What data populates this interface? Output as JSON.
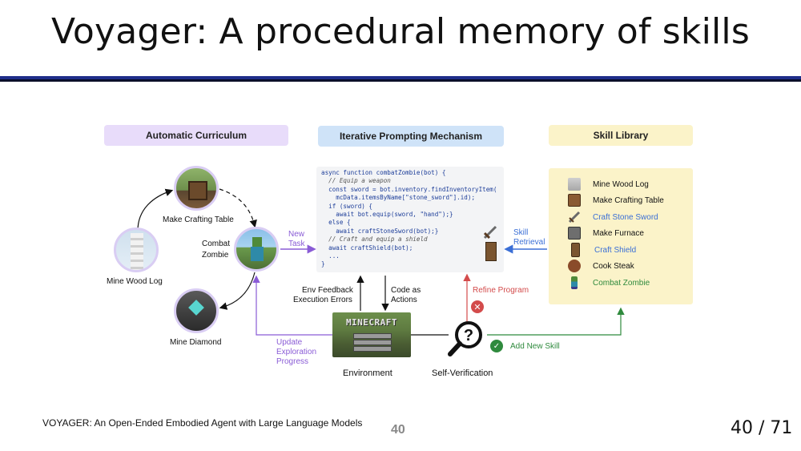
{
  "slide": {
    "title": "Voyager: A procedural memory of skills",
    "footer_left": "VOYAGER: An Open-Ended Embodied Agent with Large Language Models",
    "footer_center": "40",
    "page_indicator": "40 / 71"
  },
  "diagram": {
    "headers": {
      "curriculum": "Automatic Curriculum",
      "iterative": "Iterative Prompting Mechanism",
      "library": "Skill Library"
    },
    "curriculum_nodes": {
      "crafting_table": "Make Crafting Table",
      "combat_zombie_1": "Combat",
      "combat_zombie_2": "Zombie",
      "wood_log": "Mine Wood Log",
      "diamond": "Mine Diamond"
    },
    "code_lines": [
      "async function combatZombie(bot) {",
      "  // Equip a weapon",
      "  const sword = bot.inventory.findInventoryItem(",
      "    mcData.itemsByName[\"stone_sword\"].id);",
      "  if (sword) {",
      "    await bot.equip(sword, \"hand\");}",
      "  else {",
      "    await craftStoneSword(bot);}",
      "  // Craft and equip a shield",
      "  await craftShield(bot);",
      "  ...",
      "}"
    ],
    "labels": {
      "new_task_1": "New",
      "new_task_2": "Task",
      "skill_retrieval_1": "Skill",
      "skill_retrieval_2": "Retrieval",
      "env_feedback_1": "Env Feedback",
      "env_feedback_2": "Execution Errors",
      "code_actions_1": "Code as",
      "code_actions_2": "Actions",
      "refine_program": "Refine Program",
      "update_1": "Update",
      "update_2": "Exploration",
      "update_3": "Progress",
      "environment": "Environment",
      "self_verification": "Self-Verification",
      "add_new_skill": "Add New Skill",
      "minecraft_logo": "MINECRAFT"
    },
    "skills": [
      {
        "label": "Mine Wood  Log",
        "color": "#111111",
        "icon": "wood-log-icon"
      },
      {
        "label": "Make Crafting Table",
        "color": "#111111",
        "icon": "crafting-table-icon"
      },
      {
        "label": "Craft Stone Sword",
        "color": "#3b6fd6",
        "icon": "stone-sword-icon"
      },
      {
        "label": "Make Furnace",
        "color": "#111111",
        "icon": "furnace-icon"
      },
      {
        "label": "Craft Shield",
        "color": "#3b6fd6",
        "icon": "shield-icon"
      },
      {
        "label": "Cook Steak",
        "color": "#111111",
        "icon": "steak-icon"
      },
      {
        "label": "Combat Zombie",
        "color": "#2f8a3d",
        "icon": "zombie-icon"
      }
    ],
    "colors": {
      "curriculum": "#8a5cd6",
      "retrieval": "#3b6fd6",
      "refine": "#d34b4b",
      "add_skill": "#2f8a3d"
    }
  }
}
